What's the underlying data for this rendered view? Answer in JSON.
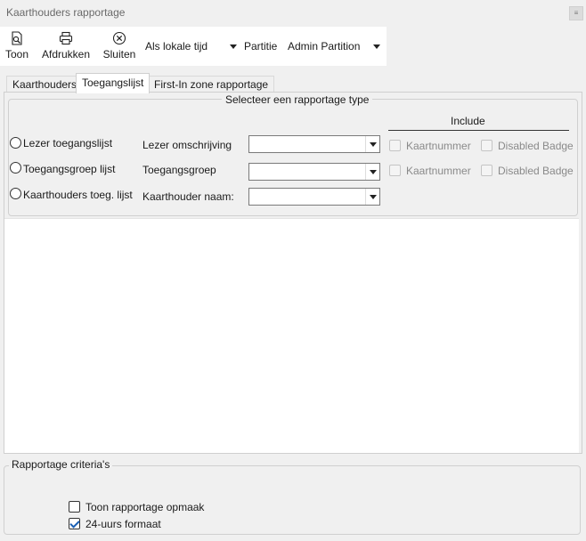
{
  "window": {
    "title": "Kaarthouders rapportage",
    "pin_glyph": "≡"
  },
  "toolbar": {
    "show_label": "Toon",
    "print_label": "Afdrukken",
    "close_label": "Sluiten",
    "time_mode": "Als lokale tijd",
    "partition_label": "Partitie",
    "partition_value": "Admin Partition"
  },
  "tabs": [
    {
      "label": "Kaarthouders"
    },
    {
      "label": "Toegangslijst"
    },
    {
      "label": "First-In zone rapportage"
    }
  ],
  "report_type": {
    "legend": "Selecteer een rapportage type",
    "options": [
      {
        "label": "Lezer toegangslijst",
        "field_label": "Lezer omschrijving",
        "field_value": ""
      },
      {
        "label": "Toegangsgroep lijst",
        "field_label": "Toegangsgroep",
        "field_value": ""
      },
      {
        "label": "Kaarthouders toeg. lijst",
        "field_label": "Kaarthouder naam:",
        "field_value": ""
      }
    ],
    "include": {
      "title": "Include",
      "rows": [
        {
          "card_number": "Kaartnummer",
          "disabled_badge": "Disabled Badge"
        },
        {
          "card_number": "Kaartnummer",
          "disabled_badge": "Disabled Badge"
        }
      ]
    }
  },
  "criteria": {
    "legend": "Rapportage criteria's",
    "show_layout": {
      "label": "Toon rapportage opmaak",
      "checked": false
    },
    "format_24h": {
      "label": "24-uurs formaat",
      "checked": true
    }
  }
}
